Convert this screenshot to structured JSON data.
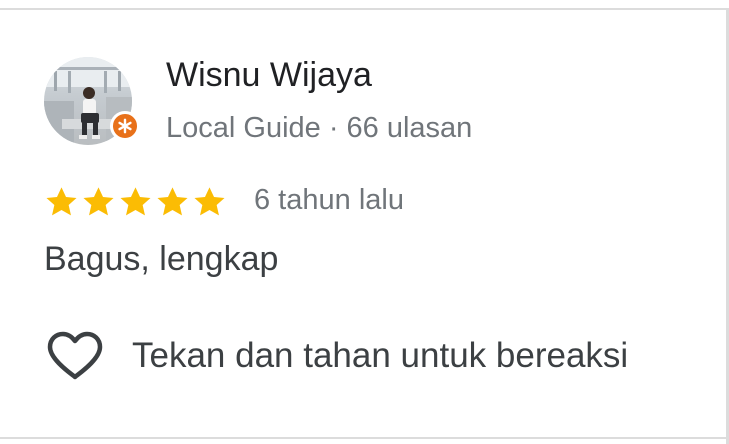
{
  "review": {
    "author_name": "Wisnu Wijaya",
    "author_meta": "Local Guide · 66 ulasan",
    "badge_icon": "local-guide-star-icon",
    "badge_color": "#e8711a",
    "rating": 5,
    "rating_max": 5,
    "star_color": "#fbbc04",
    "time_ago": "6 tahun lalu",
    "text": "Bagus, lengkap"
  },
  "actions": {
    "react_icon": "heart-outline-icon",
    "react_label": "Tekan dan tahan untuk bereaksi"
  }
}
